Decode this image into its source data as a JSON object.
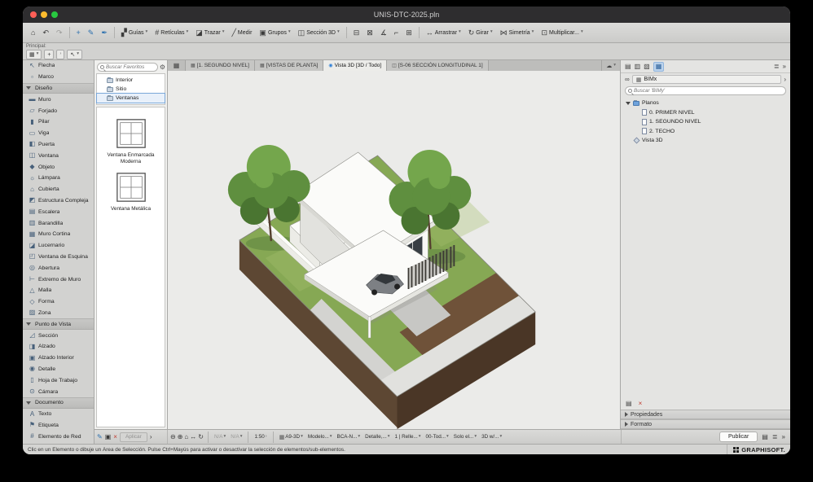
{
  "colors": {
    "accent": "#2f7fd6",
    "canvas": "#ebebe9",
    "grass": "#86a854",
    "soil1": "#5d4733",
    "soil2": "#4a3626",
    "dirt": "#6f5239",
    "pavement": "#e1e1de",
    "street": "#d3d3d0",
    "tree1": "#4a7531",
    "tree2": "#5f8f3f",
    "tree3": "#74a64c",
    "trunk": "#54402e"
  },
  "titlebar": {
    "title": "UNIS-DTC-2025.pln"
  },
  "toolbar": {
    "guides": "Guías",
    "grids": "Retículas",
    "trace": "Trazar",
    "measure": "Medir",
    "groups": "Grupos",
    "section3d": "Sección 3D",
    "drag": "Arrastrar",
    "rotate": "Girar",
    "mirror": "Simetría",
    "multiply": "Multiplicar..."
  },
  "toolbar2": {
    "principal": "Principal:"
  },
  "toolbox": {
    "items": [
      {
        "t": "tool",
        "icon": "↖",
        "label": "Flecha"
      },
      {
        "t": "tool",
        "icon": "▫",
        "label": "Marco"
      },
      {
        "t": "header",
        "icon": "",
        "label": "Diseño"
      },
      {
        "t": "tool",
        "icon": "▬",
        "label": "Muro"
      },
      {
        "t": "tool",
        "icon": "▱",
        "label": "Forjado"
      },
      {
        "t": "tool",
        "icon": "▮",
        "label": "Pilar"
      },
      {
        "t": "tool",
        "icon": "▭",
        "label": "Viga"
      },
      {
        "t": "tool",
        "icon": "◧",
        "label": "Puerta"
      },
      {
        "t": "tool",
        "icon": "◫",
        "label": "Ventana"
      },
      {
        "t": "tool",
        "icon": "◆",
        "label": "Objeto"
      },
      {
        "t": "tool",
        "icon": "☼",
        "label": "Lámpara"
      },
      {
        "t": "tool",
        "icon": "⌂",
        "label": "Cubierta"
      },
      {
        "t": "tool",
        "icon": "◩",
        "label": "Estructura Compleja"
      },
      {
        "t": "tool",
        "icon": "▤",
        "label": "Escalera"
      },
      {
        "t": "tool",
        "icon": "▥",
        "label": "Barandilla"
      },
      {
        "t": "tool",
        "icon": "▦",
        "label": "Muro Cortina"
      },
      {
        "t": "tool",
        "icon": "◪",
        "label": "Lucernario"
      },
      {
        "t": "tool",
        "icon": "◰",
        "label": "Ventana de Esquina"
      },
      {
        "t": "tool",
        "icon": "◎",
        "label": "Abertura"
      },
      {
        "t": "tool",
        "icon": "⊢",
        "label": "Extremo de Muro"
      },
      {
        "t": "tool",
        "icon": "△",
        "label": "Malla"
      },
      {
        "t": "tool",
        "icon": "◇",
        "label": "Forma"
      },
      {
        "t": "tool",
        "icon": "▨",
        "label": "Zona"
      },
      {
        "t": "header",
        "icon": "",
        "label": "Punto de Vista"
      },
      {
        "t": "tool",
        "icon": "◿",
        "label": "Sección"
      },
      {
        "t": "tool",
        "icon": "◨",
        "label": "Alzado"
      },
      {
        "t": "tool",
        "icon": "▣",
        "label": "Alzado Interior"
      },
      {
        "t": "tool",
        "icon": "◉",
        "label": "Detalle"
      },
      {
        "t": "tool",
        "icon": "▯",
        "label": "Hoja de Trabajo"
      },
      {
        "t": "tool",
        "icon": "⊙",
        "label": "Cámara"
      },
      {
        "t": "header",
        "icon": "",
        "label": "Documento"
      },
      {
        "t": "tool",
        "icon": "A",
        "label": "Texto"
      },
      {
        "t": "tool",
        "icon": "⚑",
        "label": "Etiqueta"
      },
      {
        "t": "tool",
        "icon": "#",
        "label": "Elemento de Red"
      }
    ]
  },
  "favorites": {
    "search_placeholder": "Buscar Favoritos",
    "folders": [
      {
        "label": "Interior",
        "cls": ""
      },
      {
        "label": "Sitio",
        "cls": ""
      },
      {
        "label": "Ventanas",
        "cls": "selected"
      }
    ],
    "items": [
      {
        "label": "Ventana Enmarcada Moderna"
      },
      {
        "label": "Ventana Metálica"
      }
    ],
    "apply_label": "Aplicar"
  },
  "tabs": {
    "items": [
      {
        "label": "[1. SEGUNDO NIVEL]",
        "icon": "▦",
        "cls": ""
      },
      {
        "label": "[VISTAS DE PLANTA]",
        "icon": "▦",
        "cls": ""
      },
      {
        "label": "Vista 3D [3D / Todo]",
        "icon": "◉",
        "cls": "active"
      },
      {
        "label": "[S-06 SECCIÓN LONGITUDINAL 1]",
        "icon": "◫",
        "cls": ""
      }
    ]
  },
  "navigator": {
    "project_label": "BIMx",
    "search_placeholder": "Buscar 'BIMy'",
    "tree_root": "Planos",
    "tree_items": [
      {
        "label": "0. PRIMER NIVEL",
        "cls": "ind2",
        "icon": "page"
      },
      {
        "label": "1. SEGUNDO NIVEL",
        "cls": "ind2",
        "icon": "page"
      },
      {
        "label": "2. TECHO",
        "cls": "ind2",
        "icon": "page"
      },
      {
        "label": "Vista 3D",
        "cls": "ind1",
        "icon": "cube"
      }
    ],
    "panels": [
      {
        "label": "Propiedades"
      },
      {
        "label": "Formato"
      }
    ]
  },
  "bottombar": {
    "zoom_na": "N/A",
    "rot_na": "N/A",
    "scale": "1:50",
    "layout_combo": "A9-3D",
    "dropdowns": [
      "Modelo...",
      "BCA-N...",
      "Detalle,...",
      "1 | Relle...",
      "00-Tod...",
      "Solo el...",
      "3D w/..."
    ],
    "publish": "Publicar"
  },
  "statusbar": {
    "hint": "Clic en un Elemento o dibuje un Área de Selección. Pulse Ctrl+Mayús para activar o desactivar la selección de elementos/sub-elementos.",
    "brand": "GRAPHISOFT."
  },
  "icons": {
    "home": "⌂",
    "undo": "↶",
    "redo": "↷",
    "cross": "+",
    "pencil": "✎",
    "pen": "✒",
    "guides": "▞",
    "grids": "#",
    "trace": "◪",
    "measure": "╱",
    "groups": "▣",
    "section3d": "◫",
    "split": "⊟",
    "adjust": "⊠",
    "intersect": "∡",
    "fillet": "⌐",
    "stretch": "⊞",
    "drag": "↔",
    "rotate": "↻",
    "mirror": "⋈",
    "multiply": "⊡",
    "caret": "▾",
    "chevR": "›",
    "chevRR": "»",
    "grid9": "▦",
    "cloud": "☁",
    "gear": "⚙",
    "arrowTool": "↖",
    "plus": "+",
    "close": "×",
    "map1": "▤",
    "map2": "▥",
    "map3": "▧",
    "link": "∞",
    "panel": "▤",
    "list": "≣",
    "zoomin": "⊕",
    "zoomout": "⊖",
    "pan": "↔"
  }
}
